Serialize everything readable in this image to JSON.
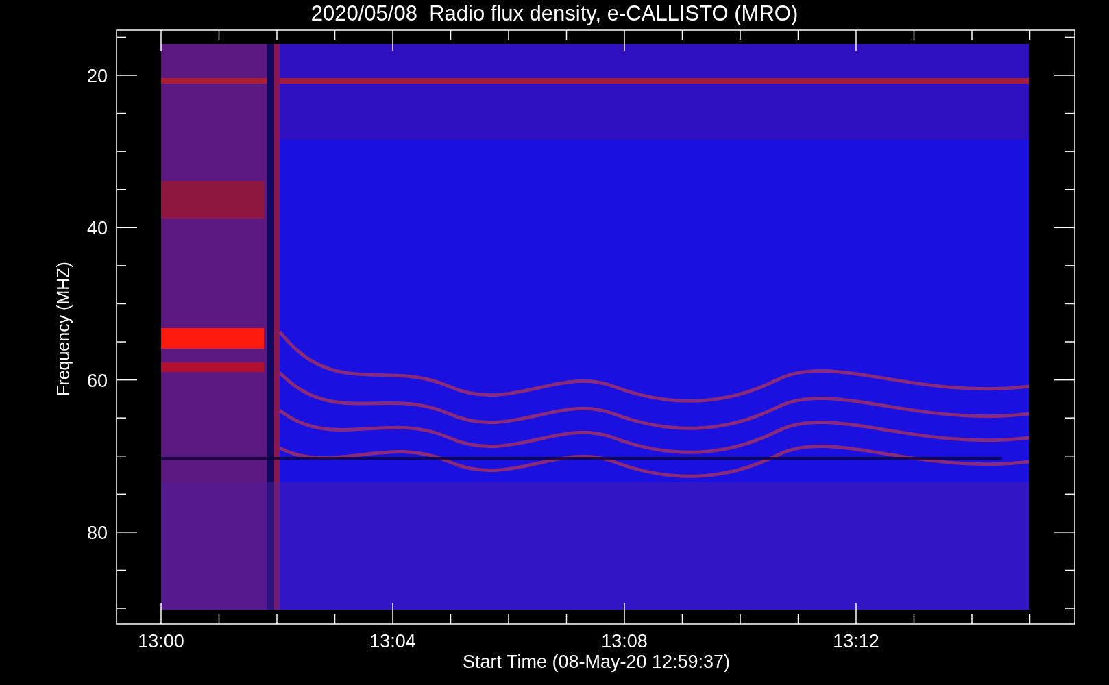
{
  "title": "2020/05/08  Radio flux density, e-CALLISTO (MRO)",
  "y_axis": {
    "label": "Frequency (MHZ)",
    "ticks": [
      "20",
      "40",
      "60",
      "80"
    ]
  },
  "x_axis": {
    "label": "Start Time (08-May-20 12:59:37)",
    "ticks": [
      "13:00",
      "13:04",
      "13:08",
      "13:12"
    ]
  }
}
